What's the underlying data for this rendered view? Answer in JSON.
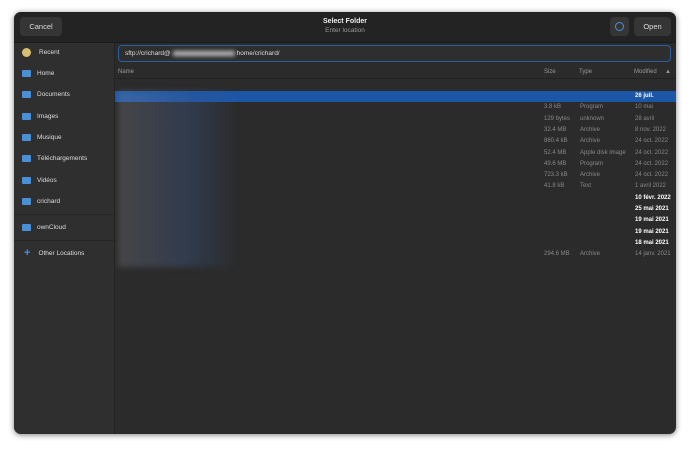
{
  "header": {
    "cancel": "Cancel",
    "title": "Select Folder",
    "subtitle": "Enter location",
    "open": "Open"
  },
  "sidebar": {
    "items": [
      {
        "label": "Recent"
      },
      {
        "label": "Home"
      },
      {
        "label": "Documents"
      },
      {
        "label": "Images"
      },
      {
        "label": "Musique"
      },
      {
        "label": "Téléchargements"
      },
      {
        "label": "Vidéos"
      },
      {
        "label": "crichard"
      },
      {
        "label": "ownCloud"
      },
      {
        "label": "Other Locations"
      }
    ]
  },
  "location": {
    "prefix": "sftp://crichard@",
    "suffix": "home/crichard/"
  },
  "columns": {
    "name": "Name",
    "size": "Size",
    "type": "Type",
    "modified": "Modified"
  },
  "rows": [
    {
      "size": "",
      "type": "",
      "modified": "26 juil.",
      "folder": true
    },
    {
      "size": "3.8 kB",
      "type": "Program",
      "modified": "10 mai"
    },
    {
      "size": "129 bytes",
      "type": "unknown",
      "modified": "28 avril"
    },
    {
      "size": "32.4 MB",
      "type": "Archive",
      "modified": "8 nov. 2022"
    },
    {
      "size": "860.4 kB",
      "type": "Archive",
      "modified": "24 oct. 2022"
    },
    {
      "size": "52.4 MB",
      "type": "Apple disk image",
      "modified": "24 oct. 2022"
    },
    {
      "size": "49.6 MB",
      "type": "Program",
      "modified": "24 oct. 2022"
    },
    {
      "size": "723.3 kB",
      "type": "Archive",
      "modified": "24 oct. 2022"
    },
    {
      "size": "41.8 kB",
      "type": "Text",
      "modified": "1 avril 2022"
    },
    {
      "size": "",
      "type": "",
      "modified": "10 févr. 2022",
      "folder": true
    },
    {
      "size": "",
      "type": "",
      "modified": "25 mai 2021",
      "folder": true
    },
    {
      "size": "",
      "type": "",
      "modified": "19 mai 2021",
      "folder": true
    },
    {
      "size": "",
      "type": "",
      "modified": "19 mai 2021",
      "folder": true
    },
    {
      "size": "",
      "type": "",
      "modified": "18 mai 2021",
      "folder": true
    },
    {
      "size": "294.6 MB",
      "type": "Archive",
      "modified": "14 janv. 2021"
    }
  ]
}
